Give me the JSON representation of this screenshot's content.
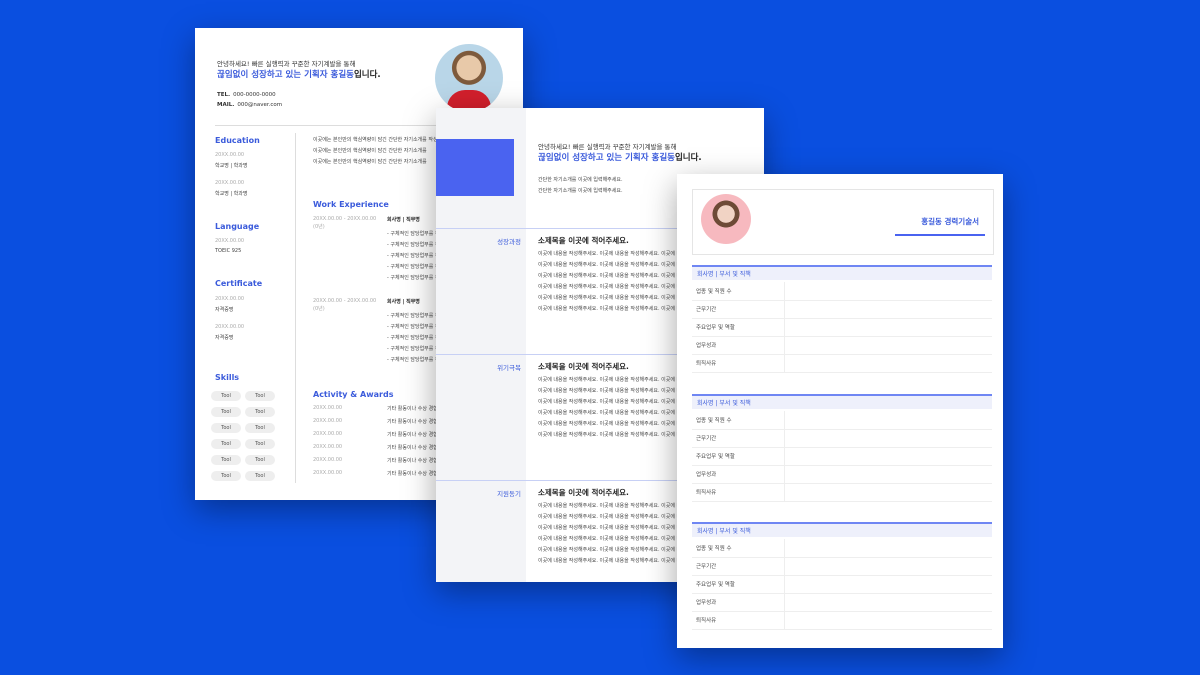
{
  "doc1": {
    "intro_line1": "안녕하세요! 빠른 실행력과 꾸준한 자기계발을 통해",
    "intro_highlight": "끊임없이 성장하고 있는 기획자 홍길동",
    "intro_tail": "입니다.",
    "tel_label": "TEL.",
    "tel_value": "000-0000-0000",
    "mail_label": "MAIL.",
    "mail_value": "000@naver.com",
    "summary_lines": [
      "이곳에는 본인만의 핵심역량이 담긴 간단한 자기소개를 작성해",
      "이곳에는 본인만의 핵심역량이 담긴 간단한 자기소개를",
      "이곳에는 본인만의 핵심역량이 담긴 간단한 자기소개를"
    ],
    "education_title": "Education",
    "education": [
      {
        "date": "20XX.00.00",
        "text": "학교명 | 학과명"
      },
      {
        "date": "20XX.00.00",
        "text": "학교명 | 학과명"
      }
    ],
    "language_title": "Language",
    "language": [
      {
        "date": "20XX.00.00",
        "text": "TOEIC 925"
      }
    ],
    "certificate_title": "Certificate",
    "certificate": [
      {
        "date": "20XX.00.00",
        "text": "자격증명"
      },
      {
        "date": "20XX.00.00",
        "text": "자격증명"
      }
    ],
    "skills_title": "Skills",
    "skills": [
      "Tool",
      "Tool",
      "Tool",
      "Tool",
      "Tool",
      "Tool",
      "Tool",
      "Tool",
      "Tool",
      "Tool",
      "Tool",
      "Tool"
    ],
    "work_title": "Work Experience",
    "work": [
      {
        "date": "20XX.00.00 - 20XX.00.00",
        "period": "(0년)",
        "company": "회사명 | 직무명",
        "bullets": [
          "- 구체적인 담당업무를 작",
          "- 구체적인 담당업무를 작",
          "- 구체적인 담당업무를 작",
          "- 구체적인 담당업무를 작",
          "- 구체적인 담당업무를 작"
        ]
      },
      {
        "date": "20XX.00.00 - 20XX.00.00",
        "period": "(0년)",
        "company": "회사명 | 직무명",
        "bullets": [
          "- 구체적인 담당업무를 작",
          "- 구체적인 담당업무를 작",
          "- 구체적인 담당업무를 작",
          "- 구체적인 담당업무를 작",
          "- 구체적인 담당업무를 작"
        ]
      }
    ],
    "activity_title": "Activity & Awards",
    "activities": [
      {
        "date": "20XX.00.00",
        "text": "기타 활동이나 수상 경험"
      },
      {
        "date": "20XX.00.00",
        "text": "기타 활동이나 수상 경험"
      },
      {
        "date": "20XX.00.00",
        "text": "기타 활동이나 수상 경험"
      },
      {
        "date": "20XX.00.00",
        "text": "기타 활동이나 수상 경험"
      },
      {
        "date": "20XX.00.00",
        "text": "기타 활동이나 수상 경험"
      },
      {
        "date": "20XX.00.00",
        "text": "기타 활동이나 수상 경험"
      }
    ]
  },
  "doc2": {
    "intro_line1": "안녕하세요! 빠른 실행력과 꾸준한 자기계발을 통해",
    "intro_highlight": "끊임없이 성장하고 있는 기획자 홍길동",
    "intro_tail": "입니다.",
    "sub_lines": [
      "간단한 자기소개를 이곳에 입력해주세요.",
      "간단한 자기소개를 이곳에 입력해주세요."
    ],
    "sections": [
      {
        "label": "성장과정",
        "heading": "소제목을 이곳에 적어주세요."
      },
      {
        "label": "위기극복",
        "heading": "소제목을 이곳에 적어주세요."
      },
      {
        "label": "지원동기",
        "heading": "소제목을 이곳에 적어주세요."
      }
    ],
    "body_text": "이곳에 내용을 작성해주세요. 이곳에 내용을 작성해주세요. 이곳에 내용"
  },
  "doc3": {
    "title": "홍길동 경력기술서",
    "blocks": [
      {
        "header": "회사명 | 부서 및 직책",
        "rows": [
          "업종 및 직원 수",
          "근무기간",
          "주요업무 및 역할",
          "업무성과",
          "퇴직사유"
        ]
      },
      {
        "header": "회사명 | 부서 및 직책",
        "rows": [
          "업종 및 직원 수",
          "근무기간",
          "주요업무 및 역할",
          "업무성과",
          "퇴직사유"
        ]
      },
      {
        "header": "회사명 | 부서 및 직책",
        "rows": [
          "업종 및 직원 수",
          "근무기간",
          "주요업무 및 역할",
          "업무성과",
          "퇴직사유"
        ]
      }
    ]
  }
}
